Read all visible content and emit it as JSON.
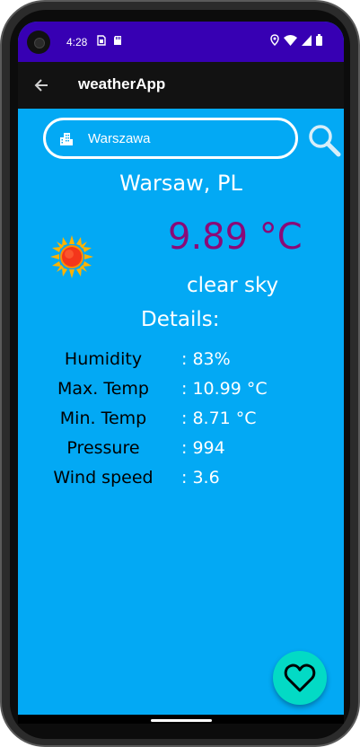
{
  "status_bar": {
    "time": "4:28",
    "left_icons": [
      "sim-icon",
      "storage-icon"
    ],
    "right_icons": [
      "location-icon",
      "wifi-icon",
      "signal-icon",
      "battery-icon"
    ]
  },
  "app_bar": {
    "title": "weatherApp",
    "back_icon": "arrow-back-icon"
  },
  "search": {
    "value": "Warszawa",
    "placeholder": "",
    "city_icon": "city-icon",
    "search_icon": "search-icon"
  },
  "weather": {
    "location": "Warsaw, PL",
    "temperature": "9.89 °C",
    "description": "clear sky",
    "icon": "sun-icon"
  },
  "details": {
    "heading": "Details:",
    "rows": [
      {
        "label": "Humidity",
        "value": ": 83%"
      },
      {
        "label": "Max. Temp",
        "value": ": 10.99 °C"
      },
      {
        "label": "Min. Temp",
        "value": ": 8.71 °C"
      },
      {
        "label": "Pressure",
        "value": ": 994"
      },
      {
        "label": "Wind speed",
        "value": ": 3.6"
      }
    ]
  },
  "fab": {
    "icon": "heart-icon"
  },
  "colors": {
    "status_bar": "#3700b3",
    "app_bar": "#121212",
    "background": "#03a9f4",
    "temperature": "#8a0a78",
    "fab": "#03dac5"
  }
}
